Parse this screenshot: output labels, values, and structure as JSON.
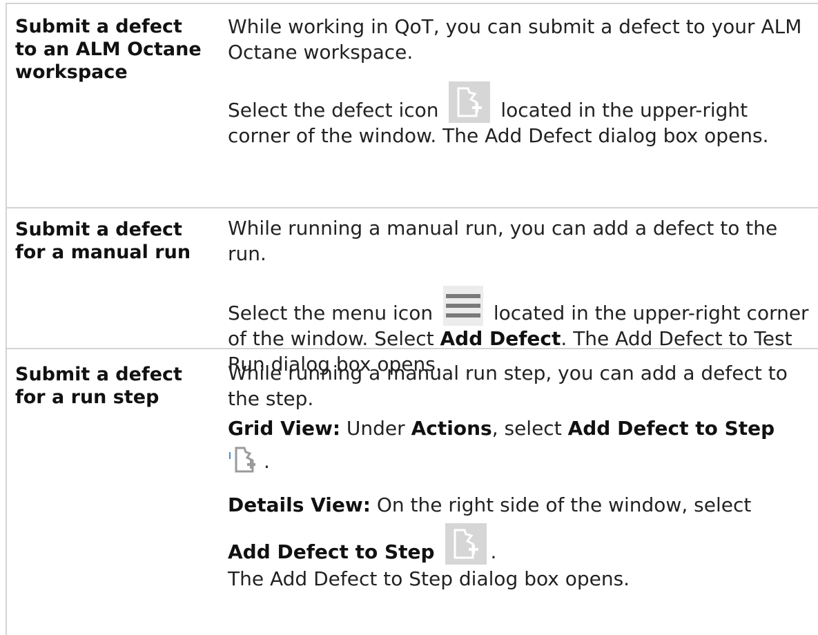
{
  "rows": [
    {
      "heading": "Submit a defect to an ALM Octane workspace",
      "para1": "While working in QoT, you can submit a defect to your ALM Octane workspace.",
      "para2_before": "Select the defect icon",
      "para2_icon": "defect-icon",
      "para2_after": "located in the upper-right corner of the window. The Add Defect dialog box opens."
    },
    {
      "heading": "Submit a defect for a manual run",
      "para1": "While running a manual run, you can add a defect to the run.",
      "para2_before": "Select the menu icon",
      "para2_icon": "menu-icon",
      "para2_after": "located in the upper-right corner of the window. Select",
      "para2_bold": "Add Defect",
      "para2_end": ". The Add Defect to Test Run dialog box opens."
    },
    {
      "heading": "Submit a defect for a run step",
      "para1": "While running a manual run step, you can add a defect to the step.",
      "grid_label": "Grid View:",
      "grid_text1": "Under",
      "grid_bold1": "Actions",
      "grid_text2": ", select",
      "grid_bold2": "Add Defect to Step",
      "grid_end": ".",
      "details_label": "Details View:",
      "details_text": "On the right side of the window, select",
      "details_bold": "Add Defect to Step",
      "details_end": ".",
      "closing": "The Add Defect to Step dialog box opens."
    }
  ]
}
